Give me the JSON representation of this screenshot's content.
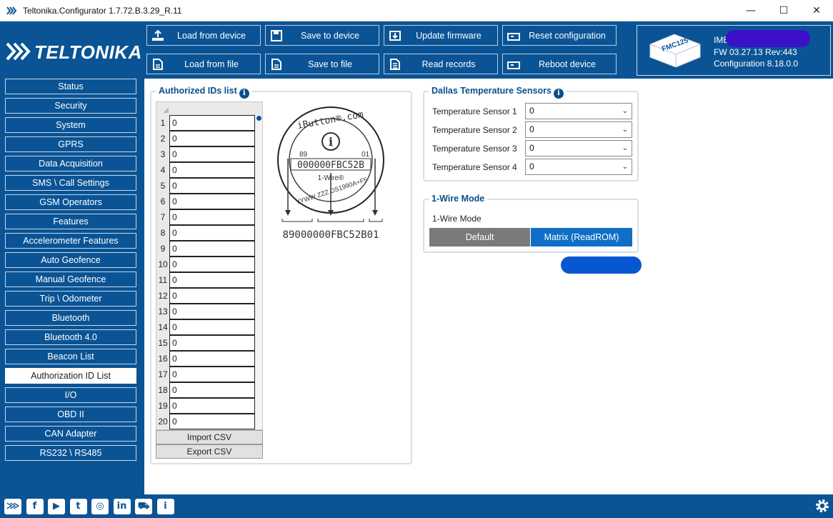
{
  "window": {
    "title": "Teltonika.Configurator 1.7.72.B.3.29_R.11",
    "minimize": "—",
    "maximize": "☐",
    "close": "✕"
  },
  "brand": {
    "logo_text": "TELTONIKA"
  },
  "toolbar": [
    {
      "label": "Load from device",
      "icon": "upload-icon"
    },
    {
      "label": "Save to device",
      "icon": "save-icon"
    },
    {
      "label": "Update firmware",
      "icon": "firmware-icon"
    },
    {
      "label": "Reset configuration",
      "icon": "reset-icon"
    },
    {
      "label": "Load from file",
      "icon": "file-load-icon"
    },
    {
      "label": "Save to file",
      "icon": "file-save-icon"
    },
    {
      "label": "Read records",
      "icon": "records-icon"
    },
    {
      "label": "Reboot device",
      "icon": "reboot-icon"
    }
  ],
  "device": {
    "model": "FMC125",
    "imei_label": "IMEI",
    "fw": "FW  03.27.13 Rev:443",
    "configuration": "Configuration  8.18.0.0"
  },
  "sidebar": [
    "Status",
    "Security",
    "System",
    "GPRS",
    "Data Acquisition",
    "SMS \\ Call Settings",
    "GSM Operators",
    "Features",
    "Accelerometer Features",
    "Auto Geofence",
    "Manual Geofence",
    "Trip \\ Odometer",
    "Bluetooth",
    "Bluetooth 4.0",
    "Beacon List",
    "Authorization ID List",
    "I/O",
    "OBD II",
    "CAN Adapter",
    "RS232 \\ RS485"
  ],
  "sidebar_active": "Authorization ID List",
  "authorized_ids": {
    "title": "Authorized IDs list",
    "rows": [
      {
        "n": "1",
        "v": "0"
      },
      {
        "n": "2",
        "v": "0"
      },
      {
        "n": "3",
        "v": "0"
      },
      {
        "n": "4",
        "v": "0"
      },
      {
        "n": "5",
        "v": "0"
      },
      {
        "n": "6",
        "v": "0"
      },
      {
        "n": "7",
        "v": "0"
      },
      {
        "n": "8",
        "v": "0"
      },
      {
        "n": "9",
        "v": "0"
      },
      {
        "n": "10",
        "v": "0"
      },
      {
        "n": "11",
        "v": "0"
      },
      {
        "n": "12",
        "v": "0"
      },
      {
        "n": "13",
        "v": "0"
      },
      {
        "n": "14",
        "v": "0"
      },
      {
        "n": "15",
        "v": "0"
      },
      {
        "n": "16",
        "v": "0"
      },
      {
        "n": "17",
        "v": "0"
      },
      {
        "n": "18",
        "v": "0"
      },
      {
        "n": "19",
        "v": "0"
      },
      {
        "n": "20",
        "v": "0"
      }
    ],
    "import_csv": "Import CSV",
    "export_csv": "Export CSV"
  },
  "ibutton": {
    "brand": "iButton®.com",
    "left_code": "89",
    "right_code": "01",
    "serial": "000000FBC52B",
    "wire": "1-Wire®",
    "bottom": "YYWW ZZZ DS1990A+F5",
    "full_id": "89000000FBC52B01"
  },
  "dallas": {
    "title": "Dallas Temperature Sensors",
    "sensors": [
      {
        "label": "Temperature Sensor 1",
        "value": "0"
      },
      {
        "label": "Temperature Sensor 2",
        "value": "0"
      },
      {
        "label": "Temperature Sensor 3",
        "value": "0"
      },
      {
        "label": "Temperature Sensor 4",
        "value": "0"
      }
    ]
  },
  "one_wire": {
    "title": "1-Wire Mode",
    "label": "1-Wire Mode",
    "options": [
      "Default",
      "Matrix (ReadROM)"
    ],
    "selected": "Matrix (ReadROM)"
  },
  "footer": {
    "icons": [
      "teltonika-icon",
      "facebook-icon",
      "youtube-icon",
      "twitter-icon",
      "instagram-icon",
      "linkedin-icon",
      "car-icon",
      "info-icon"
    ],
    "glyphs": [
      "⋙",
      "f",
      "▶",
      "t",
      "◎",
      "in",
      "⛟",
      "i"
    ]
  },
  "colors": {
    "brand_blue": "#0a5495",
    "accent_blue": "#0f6fc6",
    "default_gray": "#7a7a7a"
  }
}
